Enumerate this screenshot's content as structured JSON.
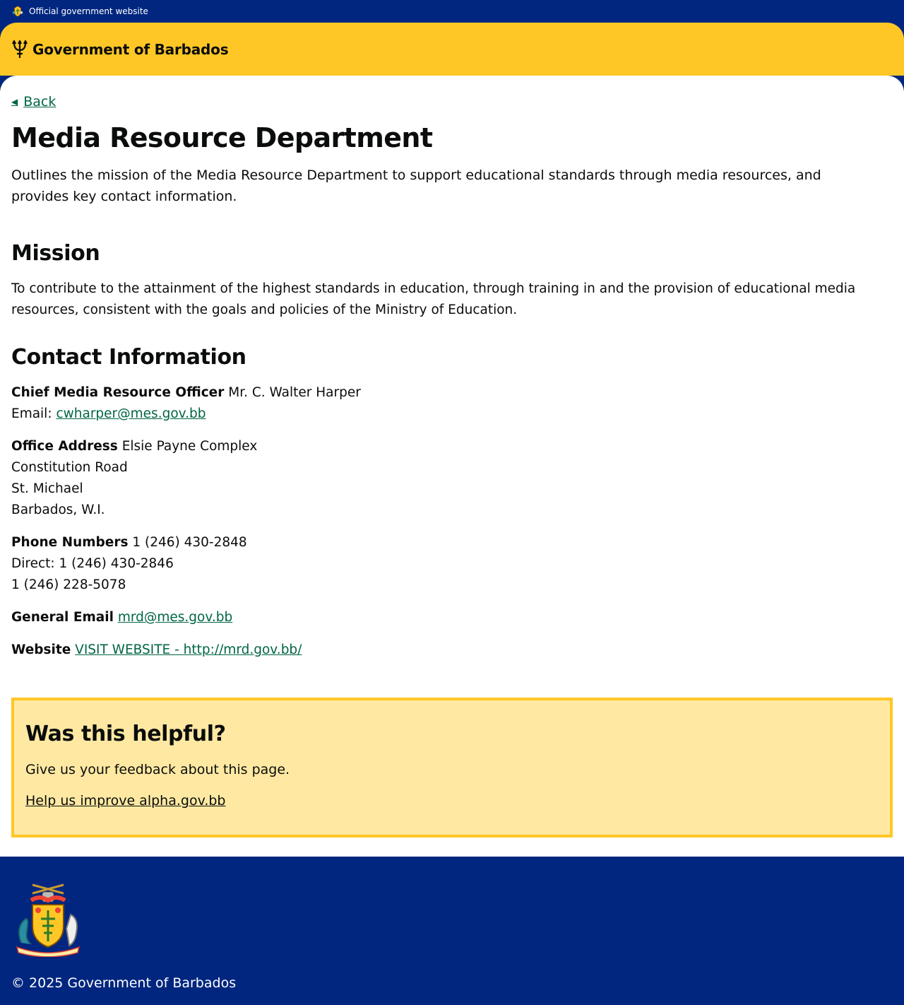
{
  "topbar": {
    "label": "Official government website"
  },
  "header": {
    "brand": "Government of Barbados"
  },
  "nav": {
    "back": "Back"
  },
  "page": {
    "title": "Media Resource Department",
    "lead": "Outlines the mission of the Media Resource Department to support educational standards through media resources, and provides key contact information."
  },
  "mission": {
    "heading": "Mission",
    "text": "To contribute to the attainment of the highest standards in education, through training in and the provision of educational media resources, consistent with the goals and policies of the Ministry of Education."
  },
  "contact": {
    "heading": "Contact Information",
    "officer_label": "Chief Media Resource Officer",
    "officer_name": "Mr. C. Walter Harper",
    "officer_email_prefix": "Email:",
    "officer_email": "cwharper@mes.gov.bb",
    "address_label": "Office Address",
    "address_lines": [
      "Elsie Payne Complex",
      "Constitution Road",
      "St. Michael",
      "Barbados, W.I."
    ],
    "phone_label": "Phone Numbers",
    "phone_lines": [
      "1 (246) 430-2848",
      "Direct: 1 (246) 430-2846",
      "1 (246) 228-5078"
    ],
    "general_email_label": "General Email",
    "general_email": "mrd@mes.gov.bb",
    "website_label": "Website",
    "website_link": "VISIT WEBSITE - http://mrd.gov.bb/"
  },
  "feedback": {
    "heading": "Was this helpful?",
    "text": "Give us your feedback about this page.",
    "link": "Help us improve alpha.gov.bb"
  },
  "footer": {
    "copyright": "© 2025 Government of Barbados"
  },
  "colors": {
    "navy": "#00267f",
    "gold": "#ffc726",
    "link_green": "#006641",
    "feedback_bg": "#ffe9a2"
  }
}
